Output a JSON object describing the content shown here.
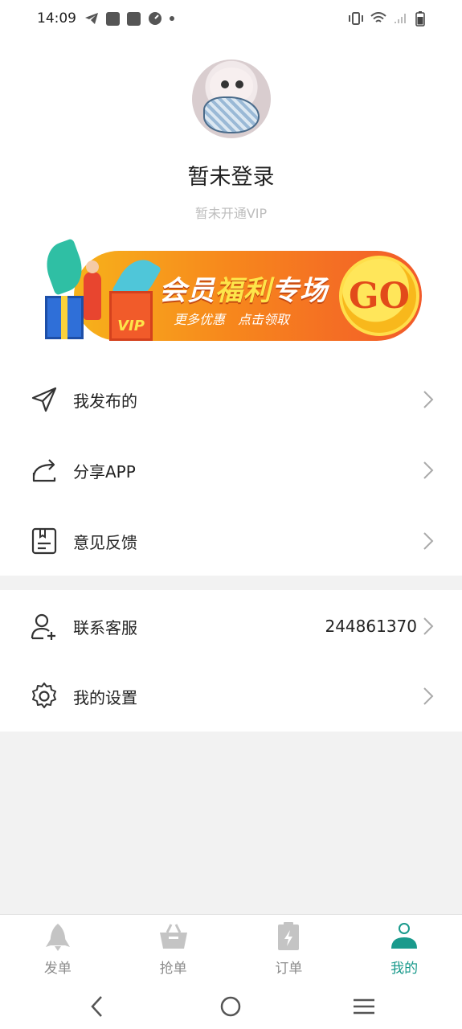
{
  "status_bar": {
    "time": "14:09"
  },
  "profile": {
    "username": "暂未登录",
    "vip_status": "暂未开通VIP"
  },
  "banner": {
    "title_part1": "会员",
    "title_highlight": "福利",
    "title_part2": "专场",
    "subtitle_left": "更多优惠",
    "subtitle_right": "点击领取",
    "go_label": "GO",
    "badge_text": "VIP"
  },
  "menu": {
    "published": "我发布的",
    "share_app": "分享APP",
    "feedback": "意见反馈",
    "contact_service": "联系客服",
    "contact_number": "244861370",
    "settings": "我的设置"
  },
  "bottom_nav": {
    "items": [
      {
        "label": "发单",
        "icon": "rocket-icon",
        "active": false
      },
      {
        "label": "抢单",
        "icon": "basket-icon",
        "active": false
      },
      {
        "label": "订单",
        "icon": "clipboard-bolt-icon",
        "active": false
      },
      {
        "label": "我的",
        "icon": "user-icon",
        "active": true
      }
    ]
  },
  "colors": {
    "accent": "#1a9a8c",
    "inactive": "#8c8c8c",
    "banner_orange": "#f7871c"
  }
}
